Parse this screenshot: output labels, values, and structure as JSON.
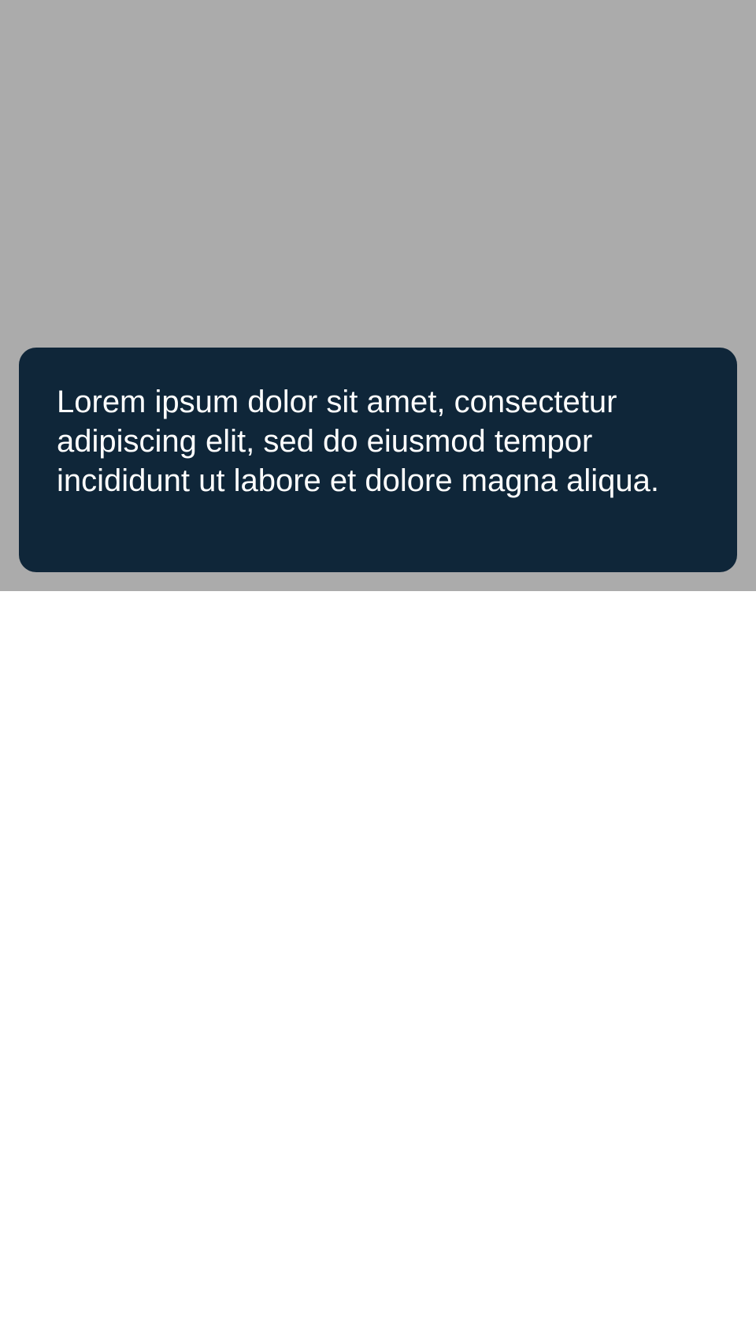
{
  "theme": {
    "scrim_color": "#ababab",
    "tooltip_background": "#0f2639",
    "tooltip_text_color": "#ffffff",
    "page_background": "#ffffff"
  },
  "tooltip": {
    "text": "Lorem ipsum dolor sit amet, consectetur adipiscing elit, sed do eiusmod tempor incididunt ut labore et dolore magna aliqua."
  }
}
